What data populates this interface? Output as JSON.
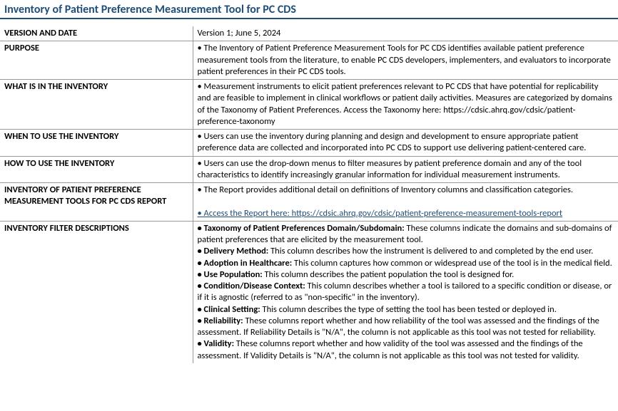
{
  "title": "Inventory of Patient Preference Measurement Tool for PC CDS",
  "rows": {
    "version": {
      "label": "VERSION AND DATE",
      "value": "Version 1; June 5, 2024"
    },
    "purpose": {
      "label": "PURPOSE",
      "bullet": "• The Inventory of Patient Preference Measurement Tools for PC CDS identifies available patient preference measurement tools from the literature, to enable PC CDS developers, implementers, and evaluators to incorporate patient preferences in their PC CDS tools."
    },
    "what": {
      "label": "WHAT IS IN THE INVENTORY",
      "bullet": "• Measurement instruments to elicit patient preferences relevant to PC CDS that have potential for replicability and are feasible to implement in clinical workflows or patient daily activities. Measures are categorized by domains of the Taxonomy of Patient Preferences. Access the Taxonomy here: https://cdsic.ahrq.gov/cdsic/patient-preference-taxonomy"
    },
    "when": {
      "label": "WHEN TO USE THE INVENTORY",
      "bullet": "• Users can use the inventory during planning and design and development to ensure appropriate patient preference data are collected and incorporated into PC CDS to support use delivering patient-centered care."
    },
    "how": {
      "label": "HOW TO USE THE INVENTORY",
      "bullet": "• Users can use the drop-down menus to filter measures by patient preference domain and any of the tool characteristics to identify increasingly granular information for individual measurement instruments."
    },
    "report": {
      "label": "INVENTORY OF PATIENT PREFERENCE MEASUREMENT TOOLS FOR PC CDS REPORT",
      "bullet": "• The Report provides additional detail on definitions of Inventory columns and classification categories.",
      "link_text": "• Access the Report here: https://cdsic.ahrq.gov/cdsic/patient-preference-measurement-tools-report"
    },
    "filters": {
      "label": "INVENTORY FILTER DESCRIPTIONS",
      "items": {
        "taxonomy": {
          "term": "• Taxonomy of Patient Preferences Domain/Subdomain:",
          "desc": " These columns indicate the domains and sub-domains of patient preferences that are elicited by the measurement tool."
        },
        "delivery": {
          "term": "• Delivery Method:",
          "desc": " This column describes how the instrument is delivered to and completed by the end user."
        },
        "adoption": {
          "term": "• Adoption in Healthcare:",
          "desc": " This column captures how common or widespread use of the tool is in the medical field."
        },
        "usepop": {
          "term": "• Use Population:",
          "desc": " This column describes the patient population the tool is designed for."
        },
        "condition": {
          "term": "• Condition/Disease Context:",
          "desc": " This column describes whether a tool is tailored to a specific condition or disease, or if it is agnostic (referred to as \"non-specific\" in the inventory)."
        },
        "clinical": {
          "term": "• Clinical Setting:",
          "desc": " This column describes the type of setting the tool has been tested or deployed in."
        },
        "reliability": {
          "term": "• Reliability:",
          "desc": " These columns report whether and how reliability of the tool was assessed and the findings of the assessment. If Reliability Details is \"N/A\", the column is not applicable as this tool was not tested for reliability."
        },
        "validity": {
          "term": "• Validity:",
          "desc": " These columns report whether and how validity of the tool was assessed and the findings of the assessment. If Validity Details is \"N/A\", the column is not applicable as  this tool was not tested for validity."
        }
      }
    }
  }
}
